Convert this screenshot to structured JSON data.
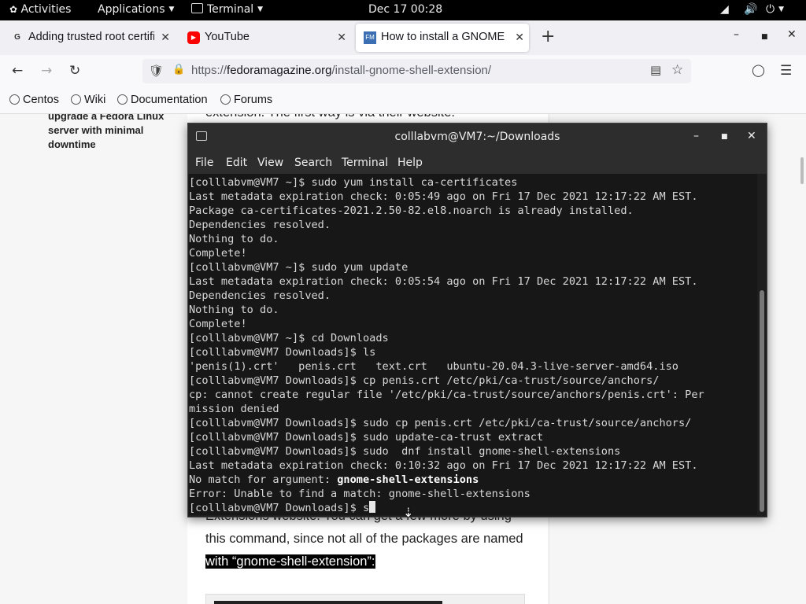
{
  "topbar": {
    "activities": "Activities",
    "applications": "Applications",
    "terminal": "Terminal",
    "clock": "Dec 17  00:28"
  },
  "tabs": [
    {
      "title": "Adding trusted root certifi",
      "favicon": "G"
    },
    {
      "title": "YouTube",
      "favicon": "play-icon"
    },
    {
      "title": "How to install a GNOME S",
      "favicon": "FM"
    }
  ],
  "browser": {
    "url_scheme": "https://",
    "url_host": "fedoramagazine.org",
    "url_path": "/install-gnome-shell-extension/"
  },
  "bookmarks": [
    "Centos",
    "Wiki",
    "Documentation",
    "Forums"
  ],
  "page": {
    "side_link": "upgrade a Fedora Linux server with minimal downtime",
    "text_top": "extension. The first way is via their website.",
    "text_line1": "Extensions website. You can get a few more by using",
    "text_line2": "this command, since not all of the packages are named",
    "text_line3": "with “gnome-shell-extension”:"
  },
  "terminal": {
    "title": "colllabvm@VM7:~/Downloads",
    "menu": [
      "File",
      "Edit",
      "View",
      "Search",
      "Terminal",
      "Help"
    ],
    "lines": [
      "[colllabvm@VM7 ~]$ sudo yum install ca-certificates",
      "Last metadata expiration check: 0:05:49 ago on Fri 17 Dec 2021 12:17:22 AM EST.",
      "Package ca-certificates-2021.2.50-82.el8.noarch is already installed.",
      "Dependencies resolved.",
      "Nothing to do.",
      "Complete!",
      "[colllabvm@VM7 ~]$ sudo yum update",
      "Last metadata expiration check: 0:05:54 ago on Fri 17 Dec 2021 12:17:22 AM EST.",
      "Dependencies resolved.",
      "Nothing to do.",
      "Complete!",
      "[colllabvm@VM7 ~]$ cd Downloads",
      "[colllabvm@VM7 Downloads]$ ls",
      "'penis(1).crt'   penis.crt   text.crt   ubuntu-20.04.3-live-server-amd64.iso",
      "[colllabvm@VM7 Downloads]$ cp penis.crt /etc/pki/ca-trust/source/anchors/",
      "cp: cannot create regular file '/etc/pki/ca-trust/source/anchors/penis.crt': Per",
      "mission denied",
      "[colllabvm@VM7 Downloads]$ sudo cp penis.crt /etc/pki/ca-trust/source/anchors/",
      "[colllabvm@VM7 Downloads]$ sudo update-ca-trust extract",
      "[colllabvm@VM7 Downloads]$ sudo  dnf install gnome-shell-extensions",
      "Last metadata expiration check: 0:10:32 ago on Fri 17 Dec 2021 12:17:22 AM EST."
    ],
    "nomatch_prefix": "No match for argument: ",
    "nomatch_arg": "gnome-shell-extensions",
    "error_line": "Error: Unable to find a match: gnome-shell-extensions",
    "prompt_line": "[colllabvm@VM7 Downloads]$ s"
  }
}
